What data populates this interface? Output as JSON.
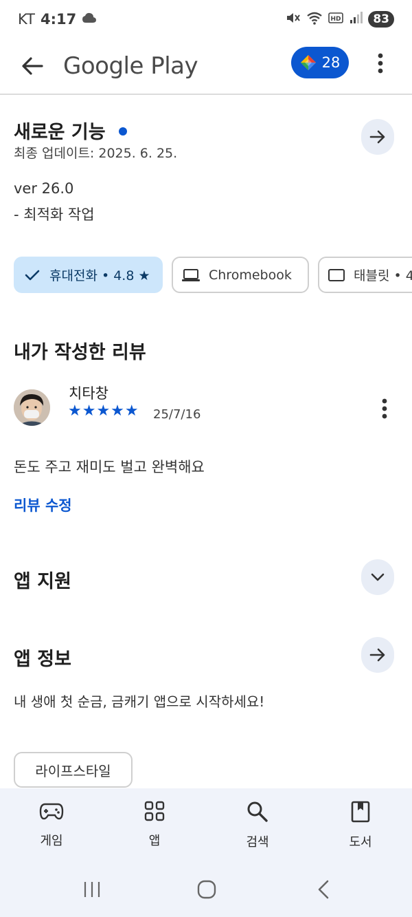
{
  "status_bar": {
    "carrier": "KT",
    "time": "4:17",
    "battery": "83"
  },
  "app_bar": {
    "title": "Google Play",
    "points": "28"
  },
  "whats_new": {
    "title": "새로운 기능",
    "updated": "최종 업데이트: 2025. 6. 25.",
    "version": "ver 26.0",
    "notes": "- 최적화 작업"
  },
  "device_chips": [
    {
      "label": "휴대전화 • 4.8 ★",
      "selected": true
    },
    {
      "label": "Chromebook",
      "selected": false
    },
    {
      "label": "태블릿 • 4",
      "selected": false
    }
  ],
  "my_review": {
    "section_title": "내가 작성한 리뷰",
    "author": "치타창",
    "rating": 5,
    "stars": "★★★★★",
    "date": "25/7/16",
    "text": "돈도 주고 재미도 벌고 완벽해요",
    "edit_link": "리뷰 수정"
  },
  "app_support": {
    "title": "앱 지원"
  },
  "app_info": {
    "title": "앱 정보",
    "description": "내 생애 첫 순금, 금캐기 앱으로 시작하세요!",
    "tag": "라이프스타일"
  },
  "bottom_nav": [
    {
      "label": "게임",
      "icon": "gamepad-icon"
    },
    {
      "label": "앱",
      "icon": "apps-grid-icon"
    },
    {
      "label": "검색",
      "icon": "search-icon"
    },
    {
      "label": "도서",
      "icon": "book-icon"
    }
  ],
  "colors": {
    "accent": "#0b57d0",
    "chip_selected": "#cde6fb",
    "nav_bg": "#f0f3fa"
  }
}
